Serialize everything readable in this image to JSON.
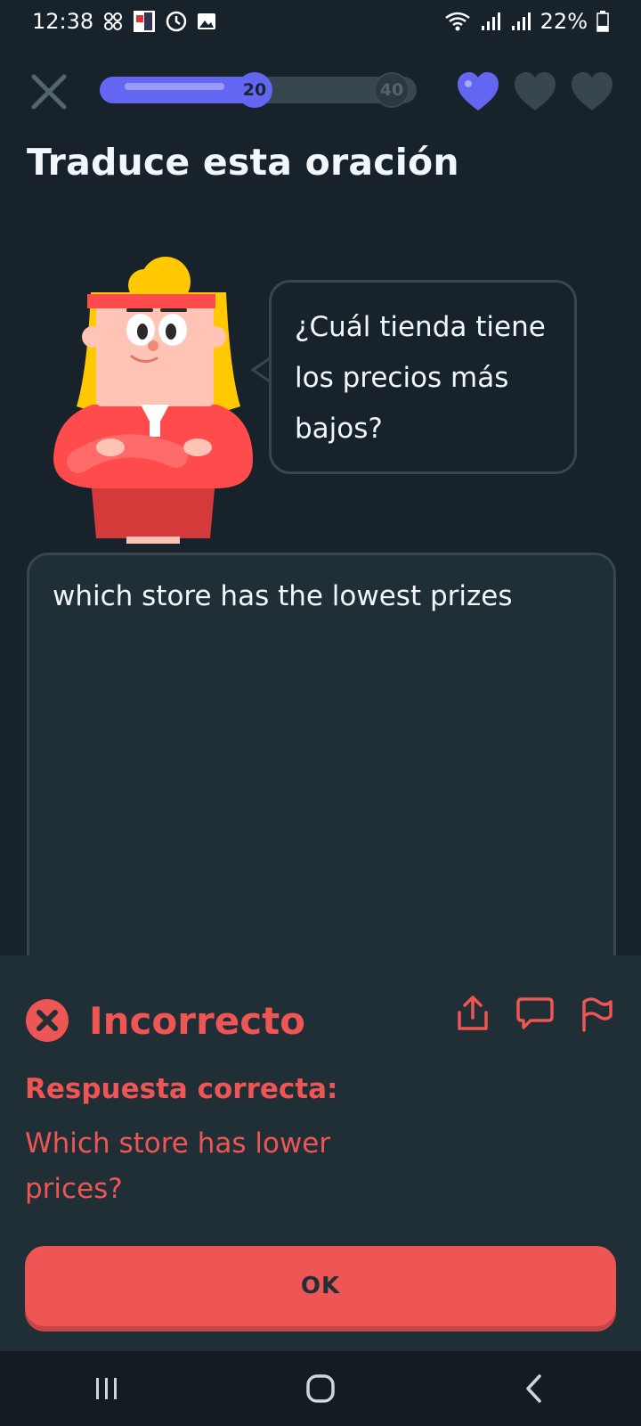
{
  "status_bar": {
    "time": "12:38",
    "battery": "22%",
    "left_icons": [
      "pinwheel-icon",
      "app-icon",
      "timer-icon",
      "image-icon"
    ],
    "right_icons": [
      "wifi-icon",
      "signal-icon",
      "signal-icon",
      "battery-icon"
    ]
  },
  "progress": {
    "current": "20",
    "goal": "40",
    "fraction": 0.5,
    "fill_color": "#6366f1"
  },
  "hearts": {
    "total": 3,
    "filled": 1,
    "filled_color": "#6366f1",
    "empty_color": "#37464f"
  },
  "title": "Traduce esta oración",
  "prompt": {
    "line1": "¿Cuál tienda tiene",
    "line2": "los precios más",
    "line3": "bajos?"
  },
  "answer": {
    "value": "which store has the lowest prizes"
  },
  "feedback": {
    "status": "Incorrecto",
    "label": "Respuesta correcta:",
    "correct_line1": "Which store has lower",
    "correct_line2": "prices?",
    "action_icons": [
      "share-icon",
      "comment-icon",
      "flag-icon"
    ],
    "accent_color": "#ee5555"
  },
  "ok_button": {
    "label": "OK"
  },
  "nav_bar": {
    "icons": [
      "recent-apps-icon",
      "home-icon",
      "back-icon"
    ]
  }
}
